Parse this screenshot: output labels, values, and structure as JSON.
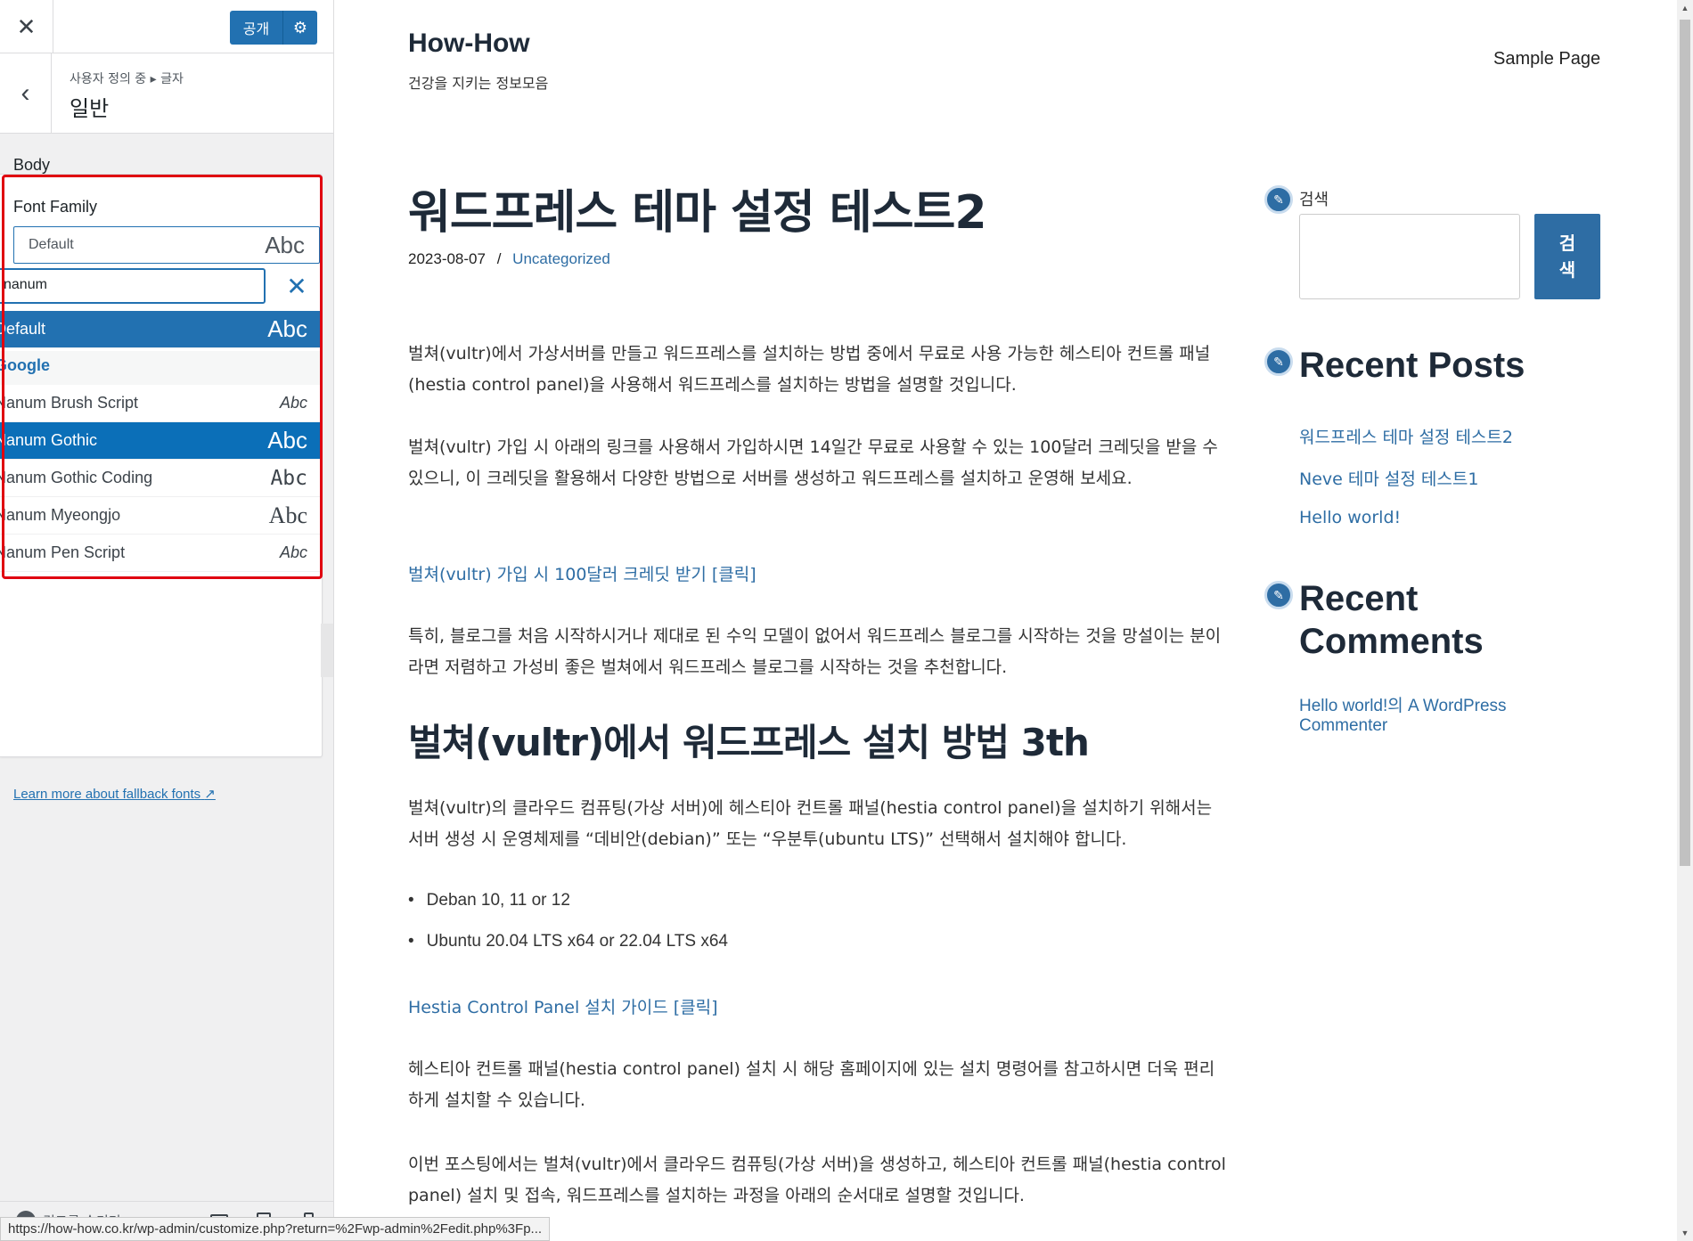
{
  "customizer": {
    "close_glyph": "✕",
    "publish_label": "공개",
    "settings_glyph": "⚙",
    "back_glyph": "‹",
    "breadcrumb": "사용자 정의 중 ▸ 글자",
    "section_title": "일반",
    "body_label": "Body",
    "font_family_label": "Font Family",
    "selected_font": "Default",
    "sample": "Abc",
    "search_value": "nanum",
    "clear_glyph": "✕",
    "options": [
      {
        "name": "Default",
        "sample": "Abc"
      },
      {
        "name": "Nanum Brush Script",
        "sample": "Abc"
      },
      {
        "name": "Nanum Gothic",
        "sample": "Abc"
      },
      {
        "name": "Nanum Gothic Coding",
        "sample": "Abc"
      },
      {
        "name": "Nanum Myeongjo",
        "sample": "Abc"
      },
      {
        "name": "Nanum Pen Script",
        "sample": "Abc"
      }
    ],
    "group_label": "Google",
    "fallback_link": "Learn more about fallback fonts",
    "fallback_glyph": "↗",
    "hide_controls": "컨트롤 숨기기",
    "accent_color": "#2271b1",
    "highlight_color": "#e00010"
  },
  "status_url": "https://how-how.co.kr/wp-admin/customize.php?return=%2Fwp-admin%2Fedit.php%3Fp...",
  "site": {
    "title": "How-How",
    "tagline": "건강을 지키는 정보모음",
    "nav": [
      "Sample Page"
    ],
    "post": {
      "title": "워드프레스 테마 설정 테스트2",
      "date": "2023-08-07",
      "separator": "/",
      "category": "Uncategorized",
      "p1": "벌쳐(vultr)에서 가상서버를 만들고 워드프레스를 설치하는 방법 중에서 무료로 사용 가능한 헤스티아 컨트롤 패널(hestia control panel)을 사용해서 워드프레스를 설치하는 방법을 설명할 것입니다.",
      "p2": "벌쳐(vultr) 가입 시 아래의 링크를 사용해서 가입하시면 14일간 무료로 사용할 수 있는 100달러 크레딧을 받을 수 있으니, 이 크레딧을 활용해서 다양한 방법으로 서버를 생성하고 워드프레스를 설치하고 운영해 보세요.",
      "link1": "벌쳐(vultr) 가입 시 100달러 크레딧 받기  [클릭]",
      "p3": "특히, 블로그를 처음 시작하시거나 제대로 된 수익 모델이 없어서 워드프레스 블로그를 시작하는 것을 망설이는 분이라면 저렴하고 가성비 좋은 벌쳐에서 워드프레스 블로그를 시작하는 것을 추천합니다.",
      "h2": "벌쳐(vultr)에서 워드프레스 설치 방법 3th",
      "p4": "벌쳐(vultr)의 클라우드 컴퓨팅(가상 서버)에 헤스티아 컨트롤 패널(hestia control panel)을 설치하기 위해서는 서버 생성 시 운영체제를 “데비안(debian)” 또는 “우분투(ubuntu LTS)” 선택해서 설치해야 합니다.",
      "bullets": [
        "Deban 10, 11 or 12",
        "Ubuntu 20.04 LTS x64 or 22.04 LTS x64"
      ],
      "link2": "Hestia Control Panel 설치 가이드 [클릭]",
      "p5": "헤스티아 컨트롤 패널(hestia control panel) 설치 시 해당 홈페이지에 있는 설치 명령어를 참고하시면 더욱 편리하게 설치할 수 있습니다.",
      "p6": "이번 포스팅에서는 벌쳐(vultr)에서 클라우드 컴퓨팅(가상 서버)을 생성하고, 헤스티아 컨트롤 패널(hestia control panel) 설치 및 접속, 워드프레스를 설치하는 과정을 아래의 순서대로 설명할 것입니다."
    },
    "sidebar": {
      "edit_glyph": "✎",
      "search_label": "검색",
      "search_button": "검색",
      "recent_posts_title": "Recent Posts",
      "recent_posts": [
        "워드프레스 테마 설정 테스트2",
        "Neve 테마 설정 테스트1",
        "Hello world!"
      ],
      "recent_comments_title": "Recent Comments",
      "comment_post": "Hello world!",
      "comment_joiner": "의 ",
      "comment_author": "A WordPress Commenter"
    },
    "link_color": "#2e6da4"
  }
}
